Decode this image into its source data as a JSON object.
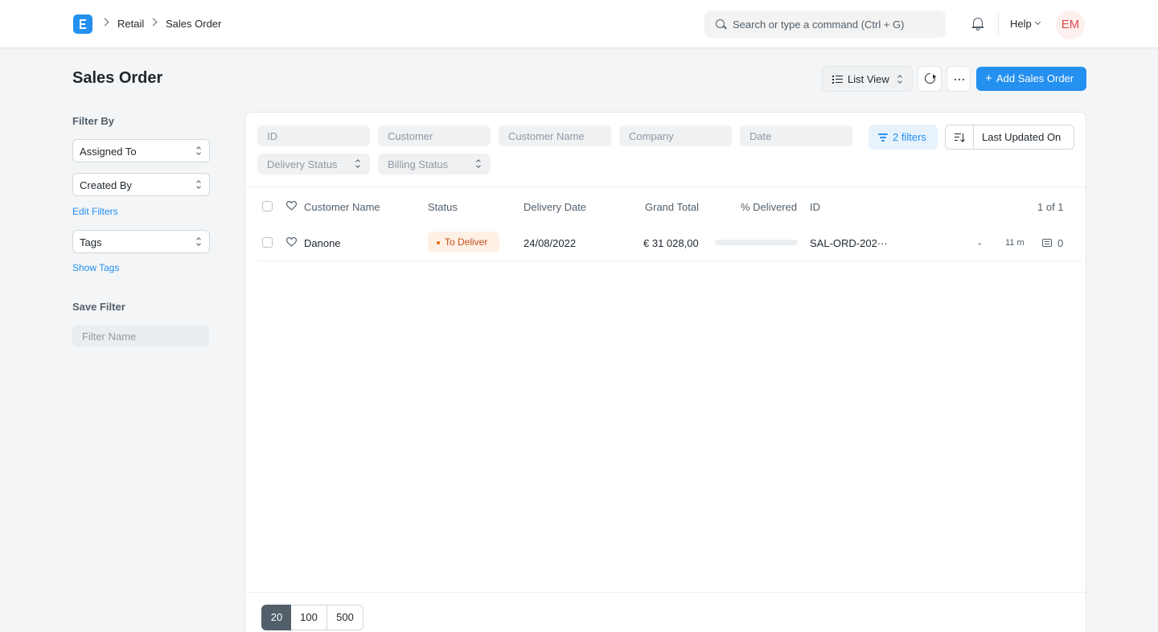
{
  "navbar": {
    "breadcrumbs": [
      "Retail",
      "Sales Order"
    ],
    "search_placeholder": "Search or type a command (Ctrl + G)",
    "help_label": "Help",
    "avatar_initials": "EM"
  },
  "page": {
    "title": "Sales Order",
    "list_view_label": "List View",
    "add_button_label": "Add Sales Order",
    "accent_color": "#2490ef"
  },
  "sidebar": {
    "filter_by_heading": "Filter By",
    "assigned_to": "Assigned To",
    "created_by": "Created By",
    "edit_filters": "Edit Filters",
    "tags": "Tags",
    "show_tags": "Show Tags",
    "save_filter_heading": "Save Filter",
    "filter_name_placeholder": "Filter Name"
  },
  "filters": {
    "id_placeholder": "ID",
    "customer_placeholder": "Customer",
    "customer_name_placeholder": "Customer Name",
    "company_placeholder": "Company",
    "date_placeholder": "Date",
    "delivery_status": "Delivery Status",
    "billing_status": "Billing Status",
    "filters_button": "2 filters",
    "sort_label": "Last Updated On"
  },
  "table": {
    "columns": {
      "customer_name": "Customer Name",
      "status": "Status",
      "delivery_date": "Delivery Date",
      "grand_total": "Grand Total",
      "percent_delivered": "% Delivered",
      "id": "ID"
    },
    "count": "1 of 1",
    "rows": [
      {
        "customer_name": "Danone",
        "status": "To Deliver",
        "status_color": "#e86c13",
        "delivery_date": "24/08/2022",
        "grand_total": "€ 31 028,00",
        "percent_delivered": 0,
        "id": "SAL-ORD-202···",
        "assigned": "-",
        "modified": "11 m",
        "comments": "0"
      }
    ]
  },
  "paging": {
    "sizes": [
      "20",
      "100",
      "500"
    ],
    "active": "20"
  }
}
